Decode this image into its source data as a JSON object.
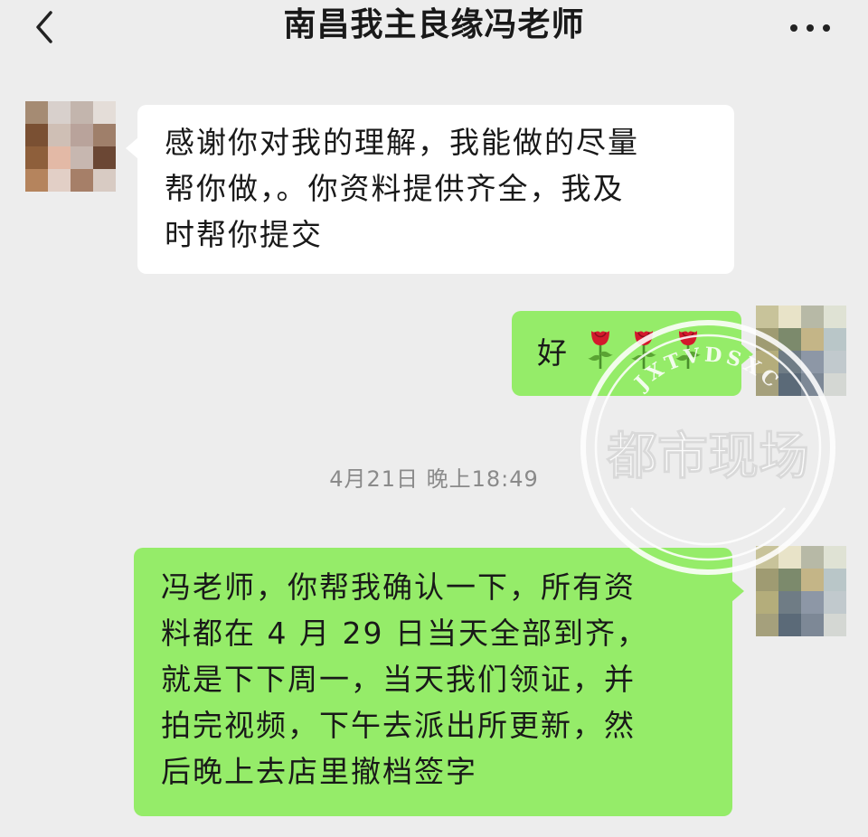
{
  "header": {
    "title": "南昌我主良缘冯老师",
    "back_icon": "chevron-left-icon",
    "more_icon": "more-horizontal-icon"
  },
  "messages": [
    {
      "side": "left",
      "text": "感谢你对我的理解，我能做的尽量帮你做，。你资料提供齐全，我及时帮你提交",
      "lines": [
        "感谢你对我的理解，我能做的尽量",
        "帮你做，。你资料提供齐全，我及",
        "时帮你提交"
      ]
    },
    {
      "side": "right",
      "text": "好🌹🌹🌹",
      "lines": [
        "好"
      ],
      "emoji": [
        "rose-icon",
        "rose-icon",
        "rose-icon"
      ]
    },
    {
      "type": "timestamp",
      "text": "4月21日 晚上18:49"
    },
    {
      "side": "right",
      "text": "冯老师，你帮我确认一下，所有资料都在 4 月 29 日当天全部到齐，就是下下周一，当天我们领证，并拍完视频，下午去派出所更新，然后晚上去店里撤档签字",
      "lines": [
        "冯老师，你帮我确认一下，所有资",
        "料都在 4 月 29 日当天全部到齐，",
        "就是下下周一，当天我们领证，并",
        "拍完视频，下午去派出所更新，然",
        "后晚上去店里撤档签字"
      ]
    }
  ],
  "watermark": {
    "main_text": "都市现场",
    "arc_text": "JXTVDSXC"
  },
  "colors": {
    "background": "#ededed",
    "bubble_left": "#ffffff",
    "bubble_right": "#95ec69",
    "timestamp": "#8a8a8a"
  }
}
